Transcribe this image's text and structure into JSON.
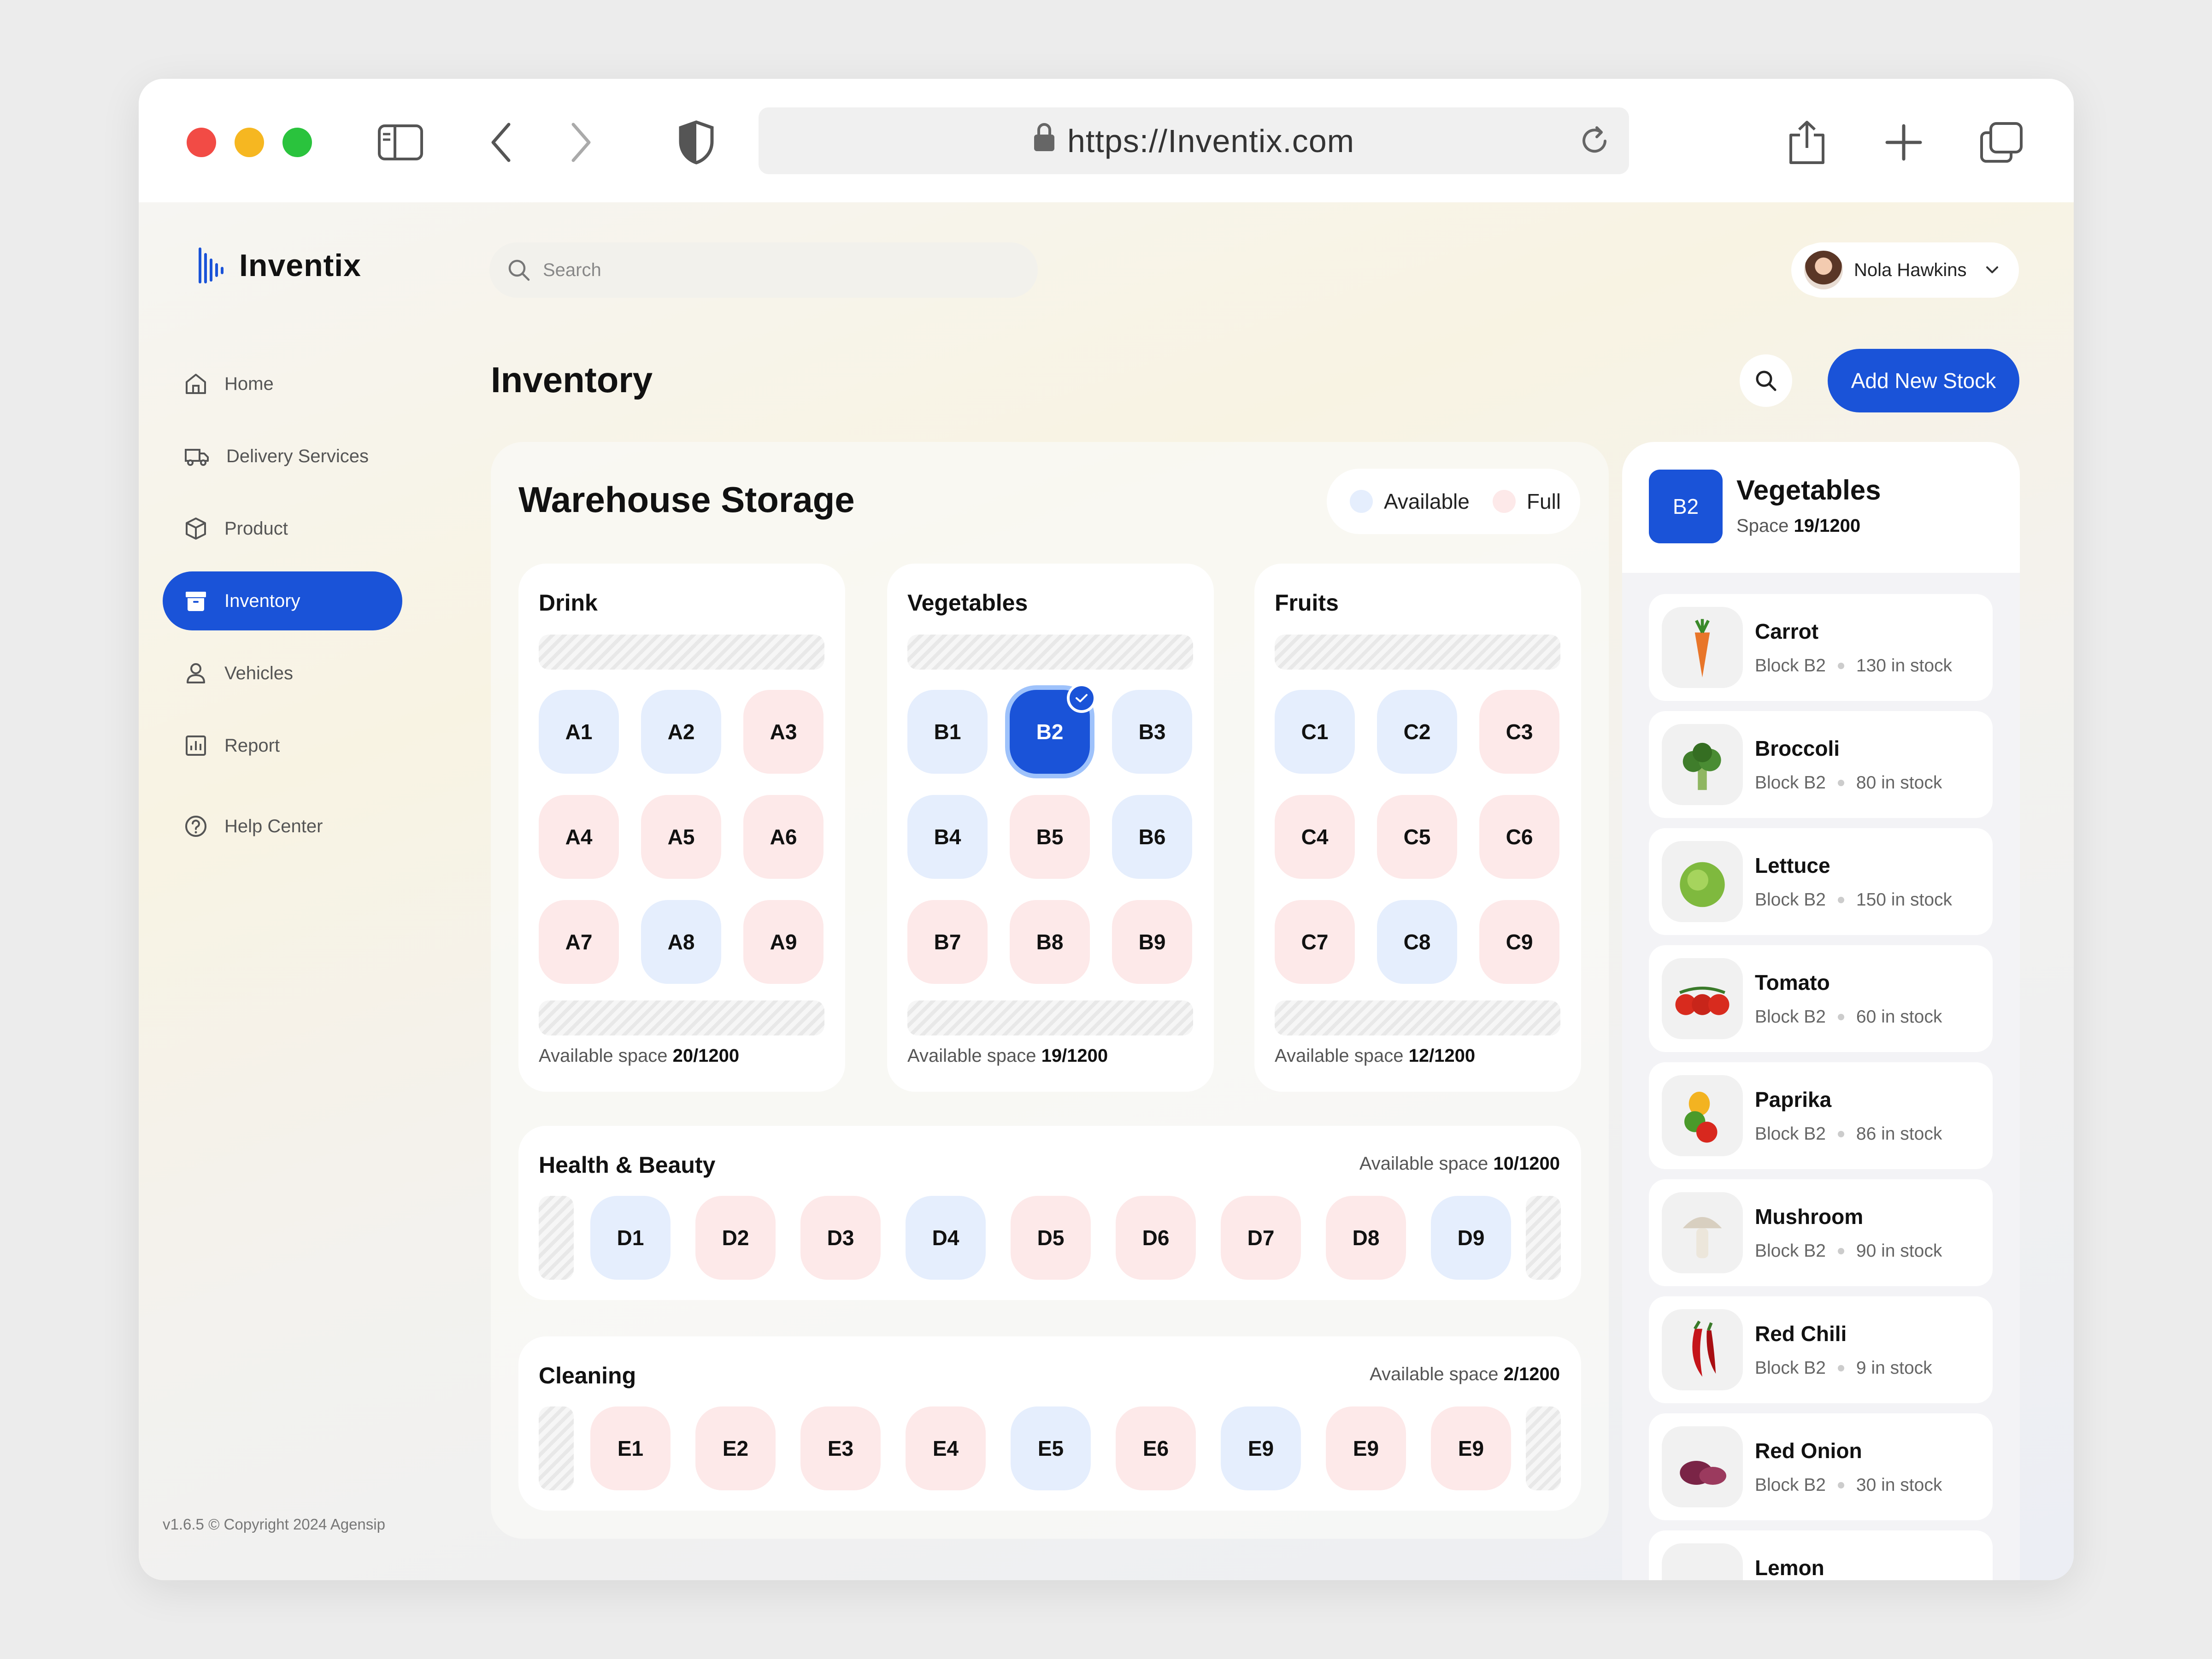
{
  "browser": {
    "url": "https://Inventix.com"
  },
  "brand": {
    "name": "Inventix"
  },
  "nav": {
    "items": [
      {
        "label": "Home",
        "icon": "home-icon"
      },
      {
        "label": "Delivery Services",
        "icon": "truck-icon"
      },
      {
        "label": "Product",
        "icon": "box-icon"
      },
      {
        "label": "Inventory",
        "icon": "archive-icon",
        "active": true
      },
      {
        "label": "Vehicles",
        "icon": "user-icon"
      },
      {
        "label": "Report",
        "icon": "chart-icon"
      }
    ],
    "help": "Help Center"
  },
  "footer": {
    "copyright": "v1.6.5 © Copyright 2024 Agensip"
  },
  "header": {
    "search_placeholder": "Search",
    "user_name": "Nola Hawkins"
  },
  "page": {
    "title": "Inventory",
    "add_button": "Add New Stock"
  },
  "warehouse": {
    "title": "Warehouse Storage",
    "legend": {
      "available": "Available",
      "full": "Full"
    },
    "avail_label": "Available space",
    "zones": [
      {
        "name": "Drink",
        "space": "20/1200",
        "cells": [
          {
            "id": "A1",
            "status": "available"
          },
          {
            "id": "A2",
            "status": "available"
          },
          {
            "id": "A3",
            "status": "full"
          },
          {
            "id": "A4",
            "status": "full"
          },
          {
            "id": "A5",
            "status": "full"
          },
          {
            "id": "A6",
            "status": "full"
          },
          {
            "id": "A7",
            "status": "full"
          },
          {
            "id": "A8",
            "status": "available"
          },
          {
            "id": "A9",
            "status": "full"
          }
        ]
      },
      {
        "name": "Vegetables",
        "space": "19/1200",
        "cells": [
          {
            "id": "B1",
            "status": "available"
          },
          {
            "id": "B2",
            "status": "selected"
          },
          {
            "id": "B3",
            "status": "available"
          },
          {
            "id": "B4",
            "status": "available"
          },
          {
            "id": "B5",
            "status": "full"
          },
          {
            "id": "B6",
            "status": "available"
          },
          {
            "id": "B7",
            "status": "full"
          },
          {
            "id": "B8",
            "status": "full"
          },
          {
            "id": "B9",
            "status": "full"
          }
        ]
      },
      {
        "name": "Fruits",
        "space": "12/1200",
        "cells": [
          {
            "id": "C1",
            "status": "available"
          },
          {
            "id": "C2",
            "status": "available"
          },
          {
            "id": "C3",
            "status": "full"
          },
          {
            "id": "C4",
            "status": "full"
          },
          {
            "id": "C5",
            "status": "full"
          },
          {
            "id": "C6",
            "status": "full"
          },
          {
            "id": "C7",
            "status": "full"
          },
          {
            "id": "C8",
            "status": "available"
          },
          {
            "id": "C9",
            "status": "full"
          }
        ]
      },
      {
        "name": "Health & Beauty",
        "space": "10/1200",
        "cells": [
          {
            "id": "D1",
            "status": "available"
          },
          {
            "id": "D2",
            "status": "full"
          },
          {
            "id": "D3",
            "status": "full"
          },
          {
            "id": "D4",
            "status": "available"
          },
          {
            "id": "D5",
            "status": "full"
          },
          {
            "id": "D6",
            "status": "full"
          },
          {
            "id": "D7",
            "status": "full"
          },
          {
            "id": "D8",
            "status": "full"
          },
          {
            "id": "D9",
            "status": "available"
          }
        ]
      },
      {
        "name": "Cleaning",
        "space": "2/1200",
        "cells": [
          {
            "id": "E1",
            "status": "full"
          },
          {
            "id": "E2",
            "status": "full"
          },
          {
            "id": "E3",
            "status": "full"
          },
          {
            "id": "E4",
            "status": "full"
          },
          {
            "id": "E5",
            "status": "available"
          },
          {
            "id": "E6",
            "status": "full"
          },
          {
            "id": "E9",
            "status": "available"
          },
          {
            "id": "E9",
            "status": "full"
          },
          {
            "id": "E9",
            "status": "full"
          }
        ]
      }
    ]
  },
  "detail": {
    "badge": "B2",
    "name": "Vegetables",
    "space_label": "Space",
    "space": "19/1200",
    "items": [
      {
        "name": "Carrot",
        "block": "Block B2",
        "stock": "130 in stock",
        "icon": "carrot-icon"
      },
      {
        "name": "Broccoli",
        "block": "Block B2",
        "stock": "80 in stock",
        "icon": "broccoli-icon"
      },
      {
        "name": "Lettuce",
        "block": "Block B2",
        "stock": "150 in stock",
        "icon": "lettuce-icon"
      },
      {
        "name": "Tomato",
        "block": "Block B2",
        "stock": "60 in stock",
        "icon": "tomato-icon"
      },
      {
        "name": "Paprika",
        "block": "Block B2",
        "stock": "86 in stock",
        "icon": "paprika-icon"
      },
      {
        "name": "Mushroom",
        "block": "Block B2",
        "stock": "90 in stock",
        "icon": "mushroom-icon"
      },
      {
        "name": "Red Chili",
        "block": "Block B2",
        "stock": "9 in stock",
        "icon": "chili-icon"
      },
      {
        "name": "Red Onion",
        "block": "Block B2",
        "stock": "30 in stock",
        "icon": "onion-icon"
      },
      {
        "name": "Lemon",
        "block": "",
        "stock": "",
        "icon": "lemon-icon"
      }
    ]
  },
  "colors": {
    "accent": "#1a53d8",
    "available": "#e5eefd",
    "full": "#fde9e9"
  }
}
